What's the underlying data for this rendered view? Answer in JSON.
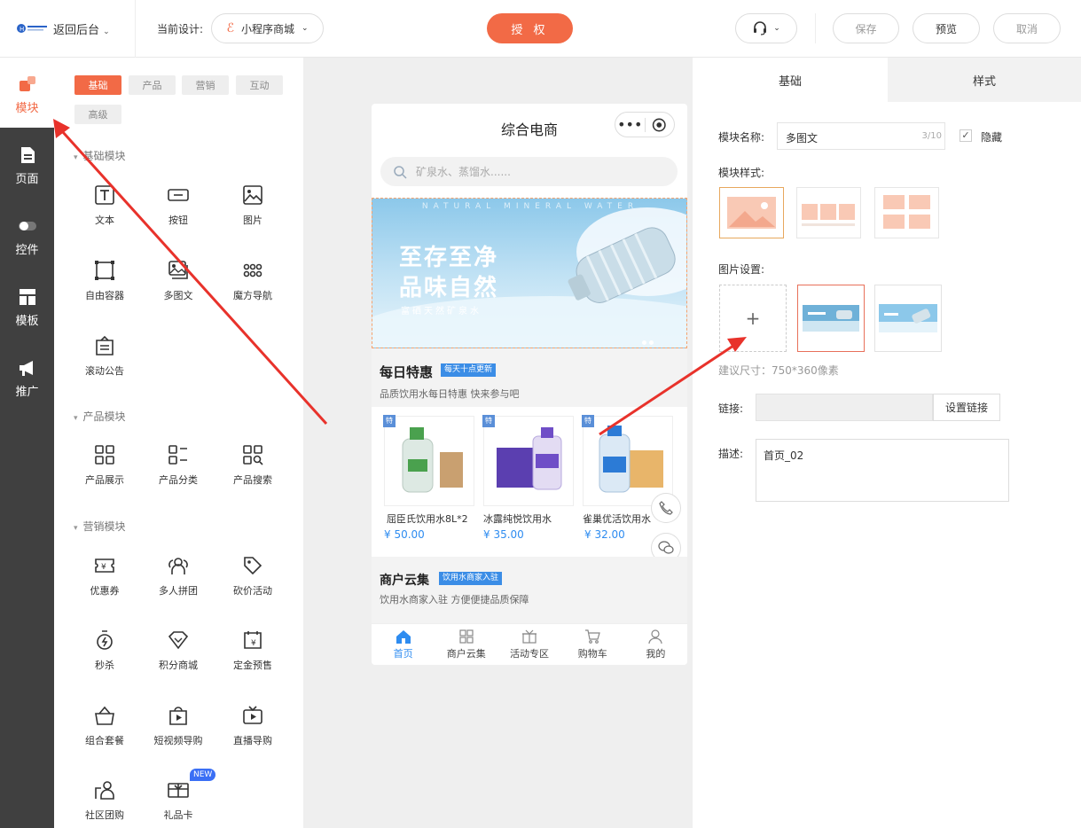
{
  "header": {
    "back_label": "返回后台",
    "current_design_label": "当前设计:",
    "design_name": "小程序商城",
    "authorize": "授 权",
    "save": "保存",
    "preview": "预览",
    "cancel": "取消"
  },
  "leftnav": [
    {
      "label": "模块"
    },
    {
      "label": "页面"
    },
    {
      "label": "控件"
    },
    {
      "label": "模板"
    },
    {
      "label": "推广"
    }
  ],
  "tabs": [
    "基础",
    "产品",
    "营销",
    "互动",
    "高级"
  ],
  "sections": {
    "basic": "基础模块",
    "product": "产品模块",
    "marketing": "营销模块"
  },
  "basic_modules": [
    "文本",
    "按钮",
    "图片",
    "自由容器",
    "多图文",
    "魔方导航",
    "滚动公告"
  ],
  "product_modules": [
    "产品展示",
    "产品分类",
    "产品搜索"
  ],
  "marketing_modules": [
    "优惠券",
    "多人拼团",
    "砍价活动",
    "秒杀",
    "积分商城",
    "定金预售",
    "组合套餐",
    "短视频导购",
    "直播导购",
    "社区团购",
    "礼品卡"
  ],
  "new_badge": "NEW",
  "phone": {
    "title": "综合电商",
    "search_placeholder": "矿泉水、蒸馏水......",
    "banner_top": "NATURAL MINERAL WATER",
    "banner_line1": "至存至净",
    "banner_line2": "品味自然",
    "banner_sub": "富硒天然矿泉水",
    "daily_title": "每日特惠",
    "daily_badge": "每天十点更新",
    "daily_sub": "品质饮用水每日特惠 快来参与吧",
    "products": [
      {
        "name": "屈臣氏饮用水8L*2",
        "price": "¥ 50.00"
      },
      {
        "name": "冰露纯悦饮用水",
        "price": "¥ 35.00"
      },
      {
        "name": "雀巢优活饮用水",
        "price": "¥ 32.00"
      }
    ],
    "merchant_title": "商户云集",
    "merchant_badge": "饮用水商家入驻",
    "merchant_sub": "饮用水商家入驻 方便便捷品质保障",
    "tabbar": [
      "首页",
      "商户云集",
      "活动专区",
      "购物车",
      "我的"
    ]
  },
  "right": {
    "tab_basic": "基础",
    "tab_style": "样式",
    "name_label": "模块名称:",
    "name_value": "多图文",
    "name_count": "3/10",
    "hide_label": "隐藏",
    "style_label": "模块样式:",
    "image_label": "图片设置:",
    "size_hint": "建议尺寸：750*360像素",
    "link_label": "链接:",
    "link_button": "设置链接",
    "desc_label": "描述:",
    "desc_value": "首页_02"
  },
  "colors": {
    "accent": "#f26a46",
    "blue": "#2e8cf0",
    "dark_nav": "#404040"
  }
}
